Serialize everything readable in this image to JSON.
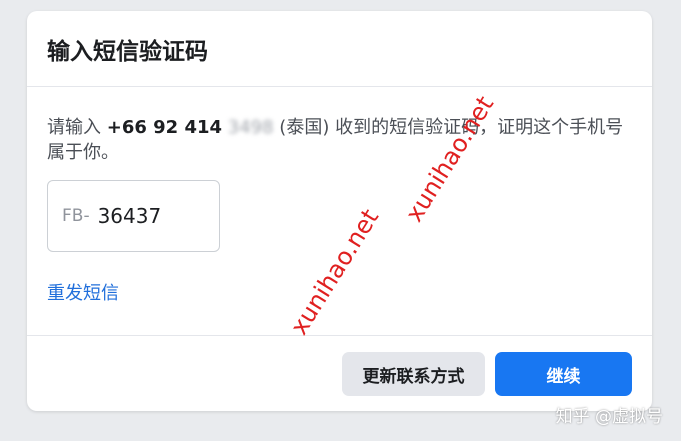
{
  "dialog": {
    "title": "输入短信验证码",
    "instruction_prefix": "请输入 ",
    "phone_visible": "+66 92 414",
    "phone_blurred": "3498",
    "instruction_suffix": " (泰国) 收到的短信验证码，证明这个手机号属于你。",
    "code_prefix": "FB-",
    "code_value": "36437",
    "resend_label": "重发短信",
    "change_method_label": "更新联系方式",
    "continue_label": "继续"
  },
  "watermarks": [
    "xunihao.net",
    "xunihao.net"
  ],
  "footer_watermark": "知乎 @虚拟号",
  "colors": {
    "primary": "#1877f2",
    "link": "#216fdb",
    "watermark": "#e02020",
    "background": "#e9ebee"
  }
}
